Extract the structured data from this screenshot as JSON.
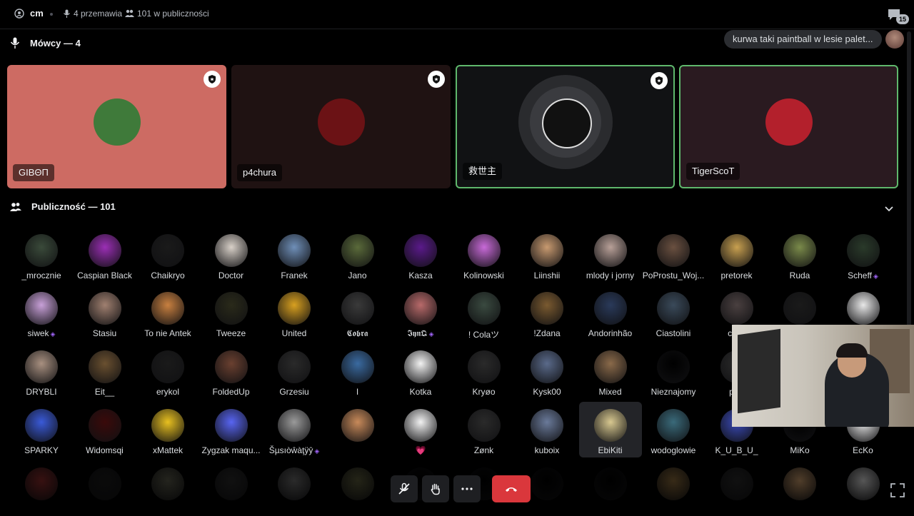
{
  "topbar": {
    "stage_name": "cm",
    "speakers_count": "4 przemawia",
    "audience_count": "101 w publiczności",
    "threads_badge": "15"
  },
  "speakers_header": "Mówcy — 4",
  "audience_header": "Publiczność — 101",
  "latest_message": "kurwa taki paintball w lesie palet...",
  "speakers": [
    {
      "name": "GIBΘΠ",
      "bg": "#cd6b63",
      "avatar_color": "#3f7a3a",
      "speaking": false
    },
    {
      "name": "p4chura",
      "bg": "#1f1212",
      "avatar_color": "#6b1215",
      "speaking": false
    },
    {
      "name": "救世主",
      "bg": "#111214",
      "avatar_color": "#111111",
      "speaking": true
    },
    {
      "name": "TigerScoT",
      "bg": "#2a1a20",
      "avatar_color": "#b3202c",
      "speaking": true
    }
  ],
  "audience": [
    [
      {
        "name": "_mrocznie",
        "color": "#3a4a3a"
      },
      {
        "name": "Caspian Black",
        "color": "#9b2fb5"
      },
      {
        "name": "Chaikryo",
        "color": "#1a1a1a"
      },
      {
        "name": "Doctor",
        "color": "#d8d0c8"
      },
      {
        "name": "Franek",
        "color": "#6f8fb8"
      },
      {
        "name": "Jano",
        "color": "#5a6a3a"
      },
      {
        "name": "Kasza",
        "color": "#5a1a8a"
      },
      {
        "name": "Kolinowski",
        "color": "#c86ad8"
      },
      {
        "name": "Liinshii",
        "color": "#c89a70"
      },
      {
        "name": "mlody i jorny",
        "color": "#b8a098"
      },
      {
        "name": "PoProstu_Woj...",
        "color": "#6a5040"
      },
      {
        "name": "pretorek",
        "color": "#c8a050"
      },
      {
        "name": "Ruda",
        "color": "#7a8a4a"
      },
      {
        "name": "Scheff",
        "color": "#2a3a2a",
        "boost": true
      }
    ],
    [
      {
        "name": "siwek",
        "color": "#c8a0d8",
        "boost": true
      },
      {
        "name": "Stasiu",
        "color": "#a08070"
      },
      {
        "name": "To nie Antek",
        "color": "#c88040"
      },
      {
        "name": "Tweeze",
        "color": "#2a2a1a"
      },
      {
        "name": "United",
        "color": "#d8a020"
      },
      {
        "name": "𝕮𝖔𝖇𝖗𝖆",
        "color": "#3a3a3a"
      },
      {
        "name": "𝕴𝖞𝖓𝕼",
        "color": "#b86a6a",
        "boost": true
      },
      {
        "name": "! Colaツ",
        "color": "#3a4a40"
      },
      {
        "name": "!Zdana",
        "color": "#7a5a30"
      },
      {
        "name": "Andorinhão",
        "color": "#2a3a5a"
      },
      {
        "name": "Ciastolini",
        "color": "#3a4a5a"
      },
      {
        "name": "czes",
        "color": "#4a4040"
      },
      {
        "name": "",
        "color": "#1a1a1a"
      },
      {
        "name": "",
        "color": "#e8e8e8"
      }
    ],
    [
      {
        "name": "DRYBLI",
        "color": "#a89080"
      },
      {
        "name": "Eit__",
        "color": "#6a5030"
      },
      {
        "name": "erykol",
        "color": "#1a1a1a"
      },
      {
        "name": "FoldedUp",
        "color": "#6a4030"
      },
      {
        "name": "Grzesiu",
        "color": "#2a2a2a"
      },
      {
        "name": "I",
        "color": "#3a6aa0"
      },
      {
        "name": "Kotka",
        "color": "#f2f2f2"
      },
      {
        "name": "Kryøo",
        "color": "#2a2a2a"
      },
      {
        "name": "Kysk00",
        "color": "#5a6a8a"
      },
      {
        "name": "Mixed",
        "color": "#8a6a4a"
      },
      {
        "name": "Nieznajomy",
        "color": "#000000"
      },
      {
        "name": "patr",
        "color": "#2a2a2a"
      },
      {
        "name": "",
        "color": "#000000"
      },
      {
        "name": "",
        "color": "#000000"
      }
    ],
    [
      {
        "name": "SPARKY",
        "color": "#3a5ad8"
      },
      {
        "name": "Widomsqi",
        "color": "#3a0a0a"
      },
      {
        "name": "xMattek",
        "color": "#e8c020"
      },
      {
        "name": "Zygzak maqu...",
        "color": "#5865f2"
      },
      {
        "name": "Šµsıòŵàţÿŷ",
        "color": "#9a9a9a",
        "boost": true
      },
      {
        "name": "",
        "color": "#c88a5a"
      },
      {
        "name": "💗",
        "color": "#f2f2f2"
      },
      {
        "name": "Zønk",
        "color": "#2a2a2a"
      },
      {
        "name": "kuboix",
        "color": "#6a7a9a"
      },
      {
        "name": "EbiKiti",
        "color": "#d8c890"
      },
      {
        "name": "wodoglowie",
        "color": "#3a6a7a"
      },
      {
        "name": "K_U_B_U_",
        "color": "#3a4ab8"
      },
      {
        "name": "MiKo",
        "color": "#000000"
      },
      {
        "name": "EcKo",
        "color": "#e8e8e8"
      }
    ],
    [
      {
        "name": "",
        "color": "#8a2a2a"
      },
      {
        "name": "",
        "color": "#1a1a1a"
      },
      {
        "name": "",
        "color": "#5a5a4a"
      },
      {
        "name": "",
        "color": "#2a2a2a"
      },
      {
        "name": "",
        "color": "#6a6a6a"
      },
      {
        "name": "",
        "color": "#5a5a3a"
      },
      {
        "name": "",
        "color": "#000000"
      },
      {
        "name": "",
        "color": "#000000"
      },
      {
        "name": "",
        "color": "#000000"
      },
      {
        "name": "",
        "color": "#000000"
      },
      {
        "name": "",
        "color": "#8a6a3a"
      },
      {
        "name": "",
        "color": "#2a2a2a"
      },
      {
        "name": "",
        "color": "#c89a6a"
      },
      {
        "name": "",
        "color": "#d8d8d8"
      }
    ]
  ],
  "hovered_member": "EbiKiti"
}
